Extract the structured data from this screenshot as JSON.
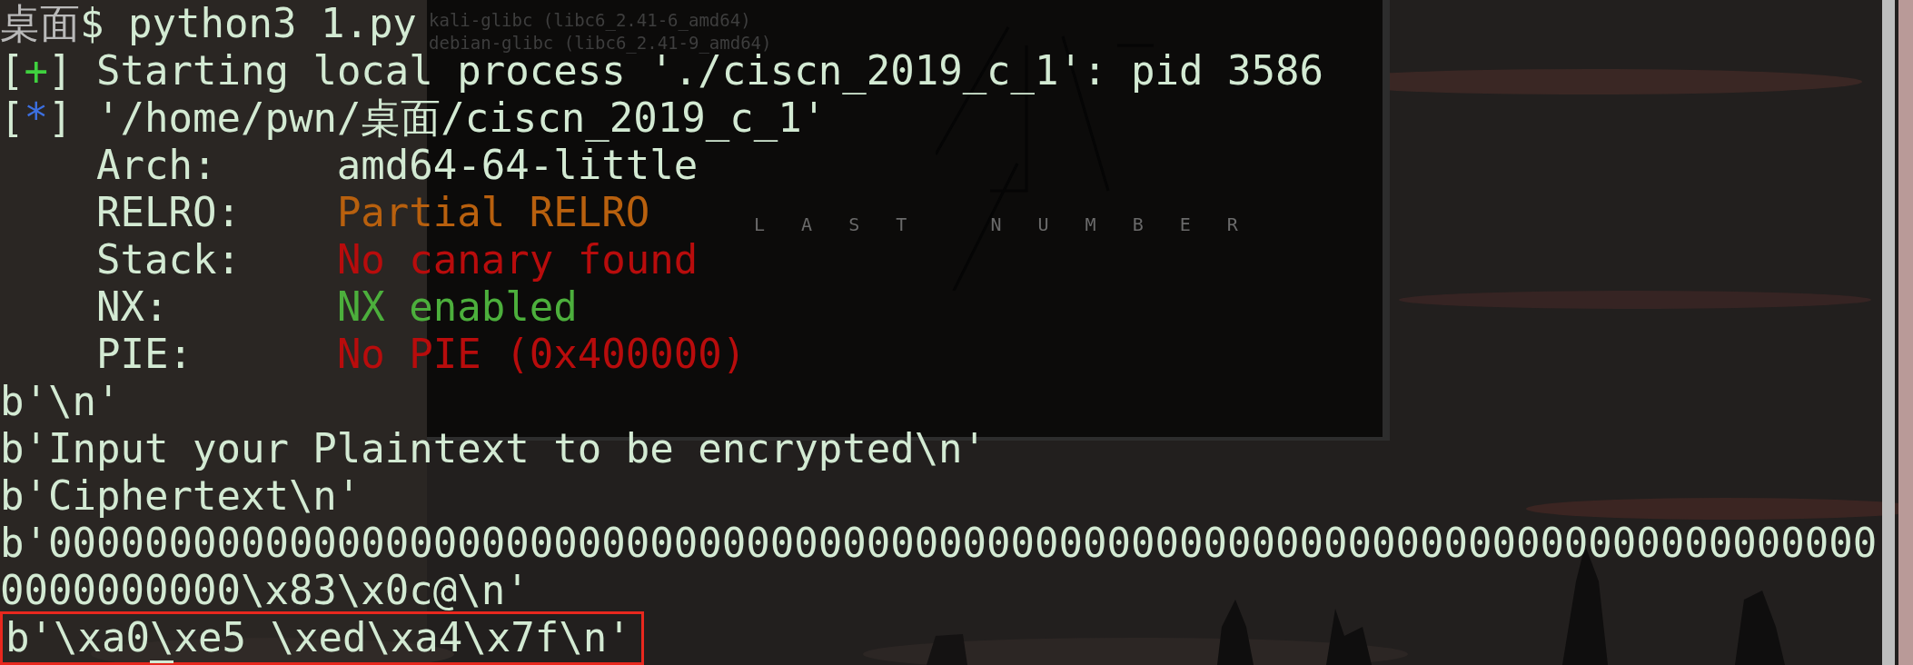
{
  "background_window": {
    "lines": [
      "kali-glibc (libc6_2.41-6_amd64)",
      "debian-glibc (libc6_2.41-9_amd64)"
    ],
    "logo_text": "L A S T   N U M B E R"
  },
  "terminal": {
    "lines": [
      {
        "segments": [
          {
            "text": "桌面",
            "color": "#b9b9b9"
          },
          {
            "text": "$ python3 1.py",
            "color": "#d3ead3"
          }
        ]
      },
      {
        "segments": [
          {
            "text": "[",
            "color": "#d3ead3"
          },
          {
            "text": "+",
            "color": "#3fd13f"
          },
          {
            "text": "] Starting local process './ciscn_2019_c_1': pid 3586",
            "color": "#d3ead3"
          }
        ]
      },
      {
        "segments": [
          {
            "text": "[",
            "color": "#d3ead3"
          },
          {
            "text": "*",
            "color": "#3c6fe0"
          },
          {
            "text": "] '/home/pwn/桌面/ciscn_2019_c_1'",
            "color": "#d3ead3"
          }
        ]
      },
      {
        "segments": [
          {
            "text": "    Arch:     amd64-64-little",
            "color": "#d3ead3"
          }
        ]
      },
      {
        "segments": [
          {
            "text": "    RELRO:    ",
            "color": "#d3ead3"
          },
          {
            "text": "Partial RELRO",
            "color": "#b8600e"
          }
        ]
      },
      {
        "segments": [
          {
            "text": "    Stack:    ",
            "color": "#d3ead3"
          },
          {
            "text": "No canary found",
            "color": "#b80c0c"
          }
        ]
      },
      {
        "segments": [
          {
            "text": "    NX:       ",
            "color": "#d3ead3"
          },
          {
            "text": "NX enabled",
            "color": "#4caf3c"
          }
        ]
      },
      {
        "segments": [
          {
            "text": "    PIE:      ",
            "color": "#d3ead3"
          },
          {
            "text": "No PIE (0x400000)",
            "color": "#b80c0c"
          }
        ]
      },
      {
        "segments": [
          {
            "text": "b'\\n'",
            "color": "#d3ead3"
          }
        ]
      },
      {
        "segments": [
          {
            "text": "b'Input your Plaintext to be encrypted\\n'",
            "color": "#d3ead3"
          }
        ]
      },
      {
        "segments": [
          {
            "text": "b'Ciphertext\\n'",
            "color": "#d3ead3"
          }
        ]
      },
      {
        "segments": [
          {
            "text": "b'0000000000000000000000000000000000000000000000000000000000000000000000000000",
            "color": "#d3ead3"
          }
        ]
      },
      {
        "segments": [
          {
            "text": "0000000000\\x83\\x0c@\\n'",
            "color": "#d3ead3"
          }
        ]
      },
      {
        "highlighted": true,
        "segments": [
          {
            "text": "b'\\xa0",
            "color": "#d3ead3"
          },
          {
            "text": "\\",
            "color": "#d3ead3",
            "cursor": true
          },
          {
            "text": "xe5 \\xed\\xa4\\x7f\\n'",
            "color": "#d3ead3"
          }
        ]
      }
    ]
  }
}
